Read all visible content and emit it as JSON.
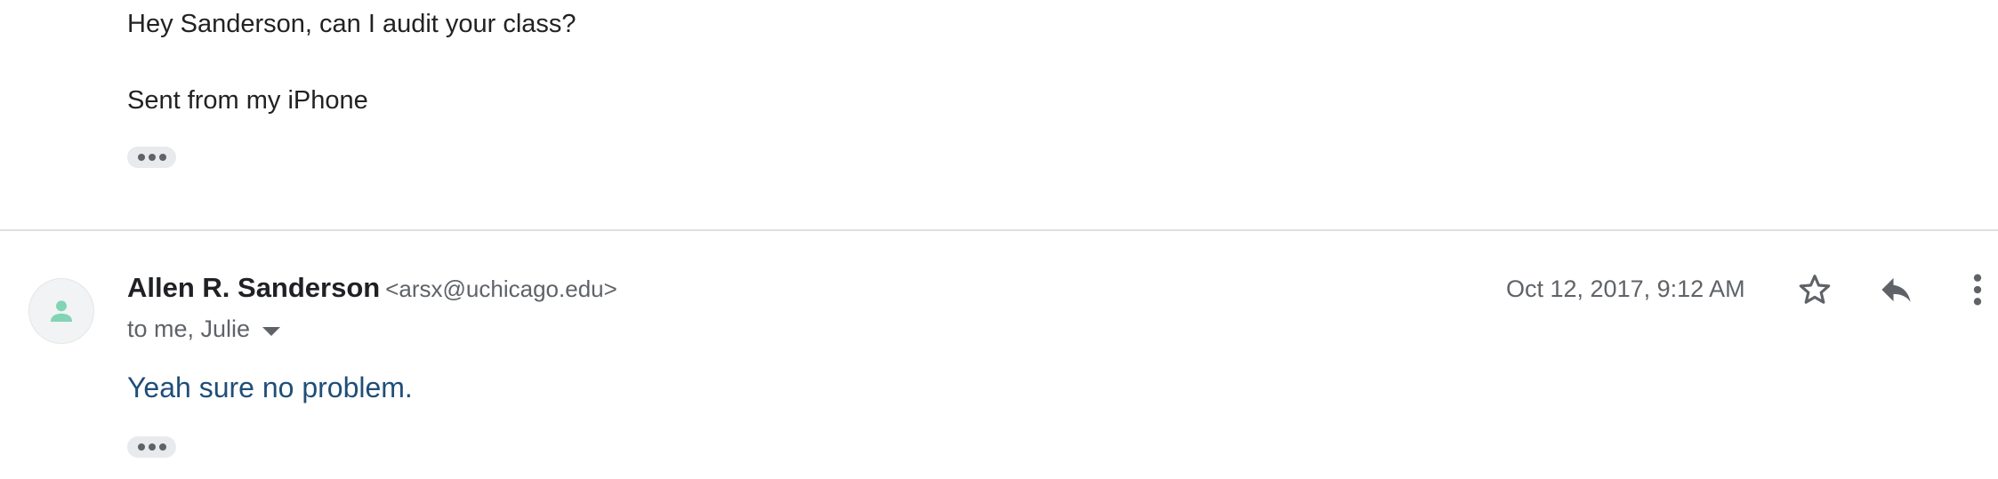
{
  "previous_message": {
    "body_line1": "Hey Sanderson, can I audit your class?",
    "body_line2": "Sent from my iPhone"
  },
  "message": {
    "sender_name": "Allen R. Sanderson",
    "sender_email": "<arsx@uchicago.edu>",
    "recipients": "to me, Julie",
    "date": "Oct 12, 2017, 9:12 AM",
    "body": "Yeah sure no problem."
  },
  "icons": {
    "avatar": "person-icon",
    "star": "star-icon",
    "reply": "reply-icon",
    "more": "more-vertical-icon",
    "expand_recipients": "chevron-down-icon",
    "trimmed_content": "ellipsis-icon"
  },
  "colors": {
    "avatar_glyph": "#81d4b4",
    "message_body": "#1f4e79",
    "secondary_text": "#5f6368"
  }
}
